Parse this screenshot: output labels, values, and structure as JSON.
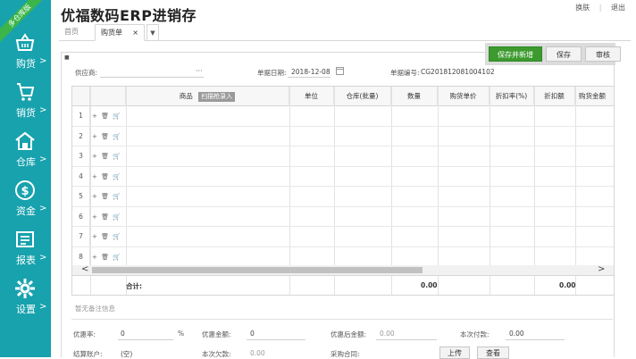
{
  "ribbon": "多仓库版",
  "sidebar": {
    "items": [
      {
        "label": "购货",
        "icon": "basket-icon"
      },
      {
        "label": "销货",
        "icon": "cart-icon"
      },
      {
        "label": "仓库",
        "icon": "warehouse-icon"
      },
      {
        "label": "资金",
        "icon": "dollar-icon"
      },
      {
        "label": "报表",
        "icon": "report-icon"
      },
      {
        "label": "设置",
        "icon": "gear-icon"
      }
    ],
    "chevron": ">"
  },
  "header": {
    "title": "优福数码ERP进销存",
    "switch_skin": "换肤",
    "logout": "退出"
  },
  "tabs": {
    "home": "首页",
    "active": "购货单",
    "close": "×",
    "more": "▼"
  },
  "toolbar": {
    "save_new": "保存并新增",
    "save": "保存",
    "audit": "审核"
  },
  "form": {
    "supplier_label": "供应商:",
    "supplier_more": "···",
    "date_label": "单据日期:",
    "date_value": "2018-12-08",
    "doc_no_label": "单据编号:",
    "doc_no_value": "CG201812081004102"
  },
  "grid": {
    "columns": {
      "goods": "商品",
      "scan_btn": "扫描枪录入",
      "unit": "单位",
      "warehouse": "仓库(批量)",
      "qty": "数量",
      "price": "购货单价",
      "discount_rate": "折扣率(%)",
      "discount_amount": "折扣额",
      "amount": "购货金额"
    },
    "row_numbers": [
      "1",
      "2",
      "3",
      "4",
      "5",
      "6",
      "7",
      "8"
    ],
    "row_ops": "+ 🗑 🛒",
    "scroll_left": "<",
    "scroll_right": ">",
    "total_label": "合计:",
    "total_qty": "0.00",
    "total_amount": "0.00"
  },
  "footer": {
    "memo_placeholder": "暂无备注信息",
    "discount_rate_label": "优惠率:",
    "discount_rate_value": "0",
    "percent": "%",
    "discount_amount_label": "优惠金额:",
    "discount_amount_value": "0",
    "after_discount_label": "优惠后金额:",
    "after_discount_value": "0.00",
    "payment_label": "本次付款:",
    "payment_value": "0.00",
    "account_label": "结算账户:",
    "account_value": "(空)",
    "owed_label": "本次欠款:",
    "owed_value": "0.00",
    "contract_label": "采购合同:",
    "upload": "上传",
    "view": "查看"
  }
}
